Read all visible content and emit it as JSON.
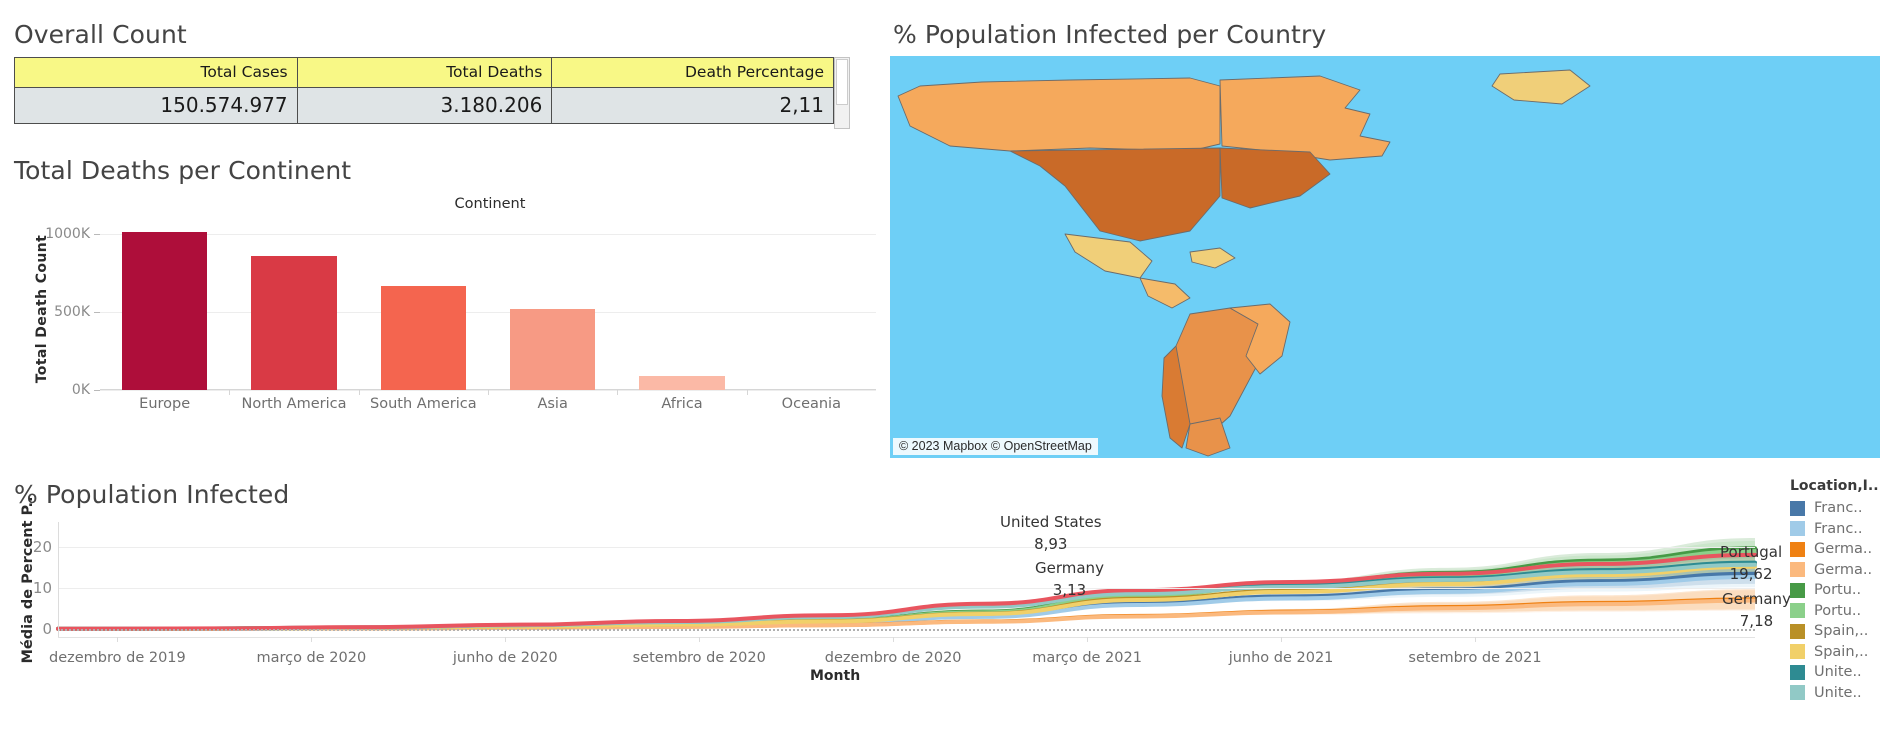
{
  "overall": {
    "title": "Overall Count",
    "headers": [
      "Total Cases",
      "Total Deaths",
      "Death Percentage"
    ],
    "values": [
      "150.574.977",
      "3.180.206",
      "2,11"
    ]
  },
  "bar_panel": {
    "title": "Total Deaths per Continent"
  },
  "map_panel": {
    "title": "% Population Infected per Country",
    "attribution": "© 2023 Mapbox © OpenStreetMap",
    "ocean_color": "#6ecff6",
    "land_colors": [
      "#e9d98a",
      "#f0cf79",
      "#f5bb6a",
      "#f5a95c",
      "#e8924a",
      "#d97b33",
      "#c96a28",
      "#bd5a1f"
    ]
  },
  "line_panel": {
    "title": "% Population Infected",
    "xlabel": "Month",
    "annotations": [
      {
        "name": "United States",
        "value": "8,93"
      },
      {
        "name": "Germany",
        "value": "3,13"
      },
      {
        "name": "Portugal",
        "value": "19,62"
      },
      {
        "name": "Germany",
        "value": "7,18"
      }
    ]
  },
  "legend": {
    "title": "Location,I..",
    "items": [
      {
        "label": "Franc..",
        "color": "#4878a8"
      },
      {
        "label": "Franc..",
        "color": "#a0cbe8"
      },
      {
        "label": "Germa..",
        "color": "#ef8113"
      },
      {
        "label": "Germa..",
        "color": "#fbb97e"
      },
      {
        "label": "Portu..",
        "color": "#479a46"
      },
      {
        "label": "Portu..",
        "color": "#8bd08a"
      },
      {
        "label": "Spain,..",
        "color": "#b99027"
      },
      {
        "label": "Spain,..",
        "color": "#f1d069"
      },
      {
        "label": "Unite..",
        "color": "#2e8b92"
      },
      {
        "label": "Unite..",
        "color": "#91c9c6"
      }
    ]
  },
  "chart_data": [
    {
      "type": "bar",
      "title": "Total Deaths per Continent",
      "xlabel": "Continent",
      "ylabel": "Total Death Count",
      "categories": [
        "Europe",
        "North America",
        "South America",
        "Asia",
        "Africa",
        "Oceania"
      ],
      "values": [
        1010000,
        855000,
        665000,
        515000,
        90000,
        0
      ],
      "ytick_labels": [
        "0K",
        "500K",
        "1000K"
      ],
      "ytick_values": [
        0,
        500000,
        1000000
      ],
      "ylim": [
        0,
        1100000
      ],
      "grid": true,
      "bar_colors": [
        "#ae0e3a",
        "#d93a45",
        "#f4654f",
        "#f79a84",
        "#fbb9a6",
        "#fddbd0"
      ]
    },
    {
      "type": "line",
      "title": "% Population Infected",
      "xlabel": "Month",
      "ylabel": "Média de Percent P..",
      "ytick_labels": [
        "0",
        "10",
        "20"
      ],
      "ytick_values": [
        0,
        10,
        20
      ],
      "ylim": [
        -2,
        26
      ],
      "grid": true,
      "legend_position": "right",
      "xtick_labels": [
        "dezembro de 2019",
        "março de 2020",
        "junho de 2020",
        "setembro de 2020",
        "dezembro de 2020",
        "março de 2021",
        "junho de 2021",
        "setembro de 2021"
      ],
      "x": [
        0,
        1,
        2,
        3,
        4,
        5,
        6,
        7,
        8,
        9,
        10,
        11
      ],
      "series": [
        {
          "name": "France",
          "color": "#4878a8",
          "values": [
            0,
            0.05,
            0.2,
            0.5,
            0.9,
            1.6,
            3.1,
            6.2,
            7.9,
            9.6,
            11.6,
            13.4
          ]
        },
        {
          "name": "France pred",
          "color": "#a0cbe8",
          "values": [
            0,
            0.04,
            0.18,
            0.45,
            0.85,
            1.5,
            2.9,
            5.8,
            7.4,
            9.0,
            10.9,
            12.6
          ]
        },
        {
          "name": "Germany",
          "color": "#ef8113",
          "values": [
            0,
            0.02,
            0.1,
            0.25,
            0.5,
            0.9,
            1.8,
            3.13,
            4.2,
            5.3,
            6.3,
            7.18
          ]
        },
        {
          "name": "Germany pred",
          "color": "#fbb97e",
          "values": [
            0,
            0.02,
            0.09,
            0.23,
            0.46,
            0.85,
            1.7,
            3.0,
            4.0,
            5.0,
            6.0,
            6.9
          ]
        },
        {
          "name": "Portugal",
          "color": "#479a46",
          "values": [
            0,
            0.06,
            0.25,
            0.6,
            1.1,
            2.1,
            4.2,
            8.4,
            11.0,
            13.6,
            16.6,
            19.62
          ]
        },
        {
          "name": "Portugal pred",
          "color": "#8bd08a",
          "values": [
            0,
            0.06,
            0.24,
            0.58,
            1.05,
            2.0,
            4.0,
            8.1,
            10.6,
            13.1,
            16.0,
            18.9
          ]
        },
        {
          "name": "Spain",
          "color": "#b99027",
          "values": [
            0,
            0.05,
            0.22,
            0.55,
            1.0,
            1.9,
            3.7,
            7.3,
            9.3,
            11.3,
            13.6,
            15.7
          ]
        },
        {
          "name": "Spain pred",
          "color": "#f1d069",
          "values": [
            0,
            0.05,
            0.21,
            0.53,
            0.97,
            1.8,
            3.6,
            7.0,
            9.0,
            10.9,
            13.1,
            15.1
          ]
        },
        {
          "name": "United States",
          "color": "#2e8b92",
          "values": [
            0,
            0.08,
            0.35,
            0.9,
            1.7,
            3.0,
            5.6,
            8.93,
            10.6,
            12.3,
            14.3,
            16.1
          ]
        },
        {
          "name": "United States pred",
          "color": "#91c9c6",
          "values": [
            0,
            0.07,
            0.33,
            0.86,
            1.62,
            2.9,
            5.4,
            8.6,
            10.2,
            11.9,
            13.8,
            15.6
          ]
        }
      ],
      "endpoint_labels": [
        {
          "series": "United States",
          "label": "United States",
          "value": "8,93"
        },
        {
          "series": "Germany",
          "label": "Germany",
          "value": "3,13"
        },
        {
          "series": "Portugal",
          "label": "Portugal",
          "value": "19,62"
        },
        {
          "series": "Germany",
          "label": "Germany",
          "value": "7,18"
        }
      ]
    }
  ]
}
